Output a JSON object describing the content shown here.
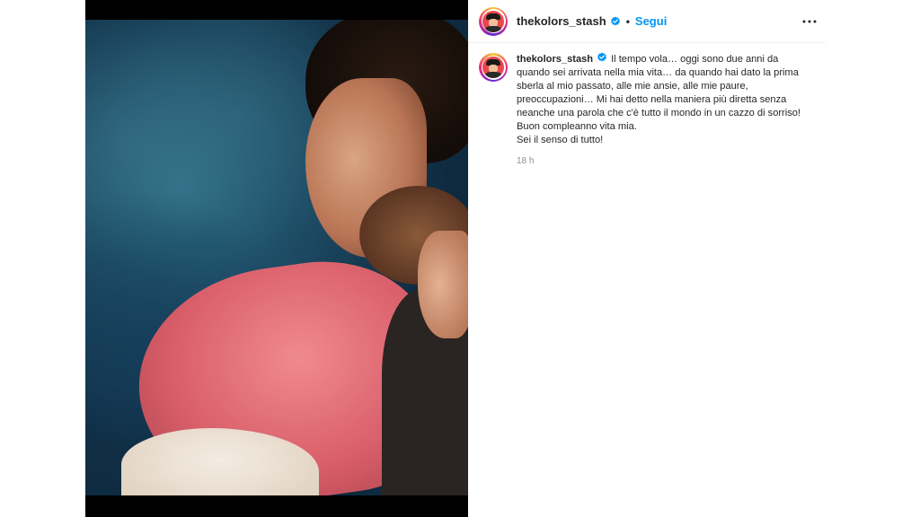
{
  "post": {
    "username": "thekolors_stash",
    "follow_label": "Segui",
    "separator": "•",
    "caption_lines": [
      "Il tempo vola… oggi sono due anni da",
      "quando sei arrivata nella mia vita… da quando hai dato la prima",
      "sberla al mio passato, alle mie ansie, alle mie paure,",
      "preoccupazioni… Mi hai detto nella maniera più diretta senza",
      "neanche una parola che c'è tutto il mondo in un cazzo di sorriso!",
      "Buon compleanno vita mia.",
      "Sei il senso di tutto!"
    ],
    "timestamp": "18 h"
  },
  "icons": {
    "verified": "verified-badge-icon",
    "more": "more-options-icon"
  },
  "colors": {
    "link_blue": "#0095f6",
    "text": "#262626",
    "muted": "#8e8e8e"
  }
}
